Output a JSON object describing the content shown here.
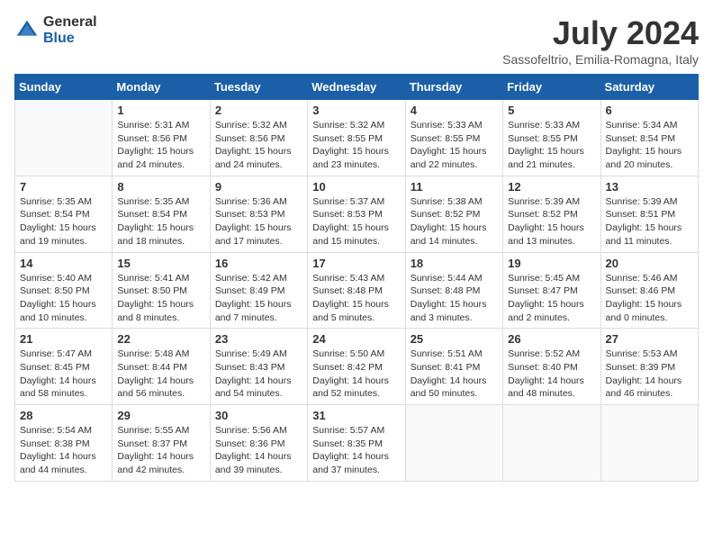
{
  "logo": {
    "general": "General",
    "blue": "Blue"
  },
  "title": "July 2024",
  "subtitle": "Sassofeltrio, Emilia-Romagna, Italy",
  "days_of_week": [
    "Sunday",
    "Monday",
    "Tuesday",
    "Wednesday",
    "Thursday",
    "Friday",
    "Saturday"
  ],
  "weeks": [
    [
      {
        "day": "",
        "info": ""
      },
      {
        "day": "1",
        "info": "Sunrise: 5:31 AM\nSunset: 8:56 PM\nDaylight: 15 hours\nand 24 minutes."
      },
      {
        "day": "2",
        "info": "Sunrise: 5:32 AM\nSunset: 8:56 PM\nDaylight: 15 hours\nand 24 minutes."
      },
      {
        "day": "3",
        "info": "Sunrise: 5:32 AM\nSunset: 8:55 PM\nDaylight: 15 hours\nand 23 minutes."
      },
      {
        "day": "4",
        "info": "Sunrise: 5:33 AM\nSunset: 8:55 PM\nDaylight: 15 hours\nand 22 minutes."
      },
      {
        "day": "5",
        "info": "Sunrise: 5:33 AM\nSunset: 8:55 PM\nDaylight: 15 hours\nand 21 minutes."
      },
      {
        "day": "6",
        "info": "Sunrise: 5:34 AM\nSunset: 8:54 PM\nDaylight: 15 hours\nand 20 minutes."
      }
    ],
    [
      {
        "day": "7",
        "info": "Sunrise: 5:35 AM\nSunset: 8:54 PM\nDaylight: 15 hours\nand 19 minutes."
      },
      {
        "day": "8",
        "info": "Sunrise: 5:35 AM\nSunset: 8:54 PM\nDaylight: 15 hours\nand 18 minutes."
      },
      {
        "day": "9",
        "info": "Sunrise: 5:36 AM\nSunset: 8:53 PM\nDaylight: 15 hours\nand 17 minutes."
      },
      {
        "day": "10",
        "info": "Sunrise: 5:37 AM\nSunset: 8:53 PM\nDaylight: 15 hours\nand 15 minutes."
      },
      {
        "day": "11",
        "info": "Sunrise: 5:38 AM\nSunset: 8:52 PM\nDaylight: 15 hours\nand 14 minutes."
      },
      {
        "day": "12",
        "info": "Sunrise: 5:39 AM\nSunset: 8:52 PM\nDaylight: 15 hours\nand 13 minutes."
      },
      {
        "day": "13",
        "info": "Sunrise: 5:39 AM\nSunset: 8:51 PM\nDaylight: 15 hours\nand 11 minutes."
      }
    ],
    [
      {
        "day": "14",
        "info": "Sunrise: 5:40 AM\nSunset: 8:50 PM\nDaylight: 15 hours\nand 10 minutes."
      },
      {
        "day": "15",
        "info": "Sunrise: 5:41 AM\nSunset: 8:50 PM\nDaylight: 15 hours\nand 8 minutes."
      },
      {
        "day": "16",
        "info": "Sunrise: 5:42 AM\nSunset: 8:49 PM\nDaylight: 15 hours\nand 7 minutes."
      },
      {
        "day": "17",
        "info": "Sunrise: 5:43 AM\nSunset: 8:48 PM\nDaylight: 15 hours\nand 5 minutes."
      },
      {
        "day": "18",
        "info": "Sunrise: 5:44 AM\nSunset: 8:48 PM\nDaylight: 15 hours\nand 3 minutes."
      },
      {
        "day": "19",
        "info": "Sunrise: 5:45 AM\nSunset: 8:47 PM\nDaylight: 15 hours\nand 2 minutes."
      },
      {
        "day": "20",
        "info": "Sunrise: 5:46 AM\nSunset: 8:46 PM\nDaylight: 15 hours\nand 0 minutes."
      }
    ],
    [
      {
        "day": "21",
        "info": "Sunrise: 5:47 AM\nSunset: 8:45 PM\nDaylight: 14 hours\nand 58 minutes."
      },
      {
        "day": "22",
        "info": "Sunrise: 5:48 AM\nSunset: 8:44 PM\nDaylight: 14 hours\nand 56 minutes."
      },
      {
        "day": "23",
        "info": "Sunrise: 5:49 AM\nSunset: 8:43 PM\nDaylight: 14 hours\nand 54 minutes."
      },
      {
        "day": "24",
        "info": "Sunrise: 5:50 AM\nSunset: 8:42 PM\nDaylight: 14 hours\nand 52 minutes."
      },
      {
        "day": "25",
        "info": "Sunrise: 5:51 AM\nSunset: 8:41 PM\nDaylight: 14 hours\nand 50 minutes."
      },
      {
        "day": "26",
        "info": "Sunrise: 5:52 AM\nSunset: 8:40 PM\nDaylight: 14 hours\nand 48 minutes."
      },
      {
        "day": "27",
        "info": "Sunrise: 5:53 AM\nSunset: 8:39 PM\nDaylight: 14 hours\nand 46 minutes."
      }
    ],
    [
      {
        "day": "28",
        "info": "Sunrise: 5:54 AM\nSunset: 8:38 PM\nDaylight: 14 hours\nand 44 minutes."
      },
      {
        "day": "29",
        "info": "Sunrise: 5:55 AM\nSunset: 8:37 PM\nDaylight: 14 hours\nand 42 minutes."
      },
      {
        "day": "30",
        "info": "Sunrise: 5:56 AM\nSunset: 8:36 PM\nDaylight: 14 hours\nand 39 minutes."
      },
      {
        "day": "31",
        "info": "Sunrise: 5:57 AM\nSunset: 8:35 PM\nDaylight: 14 hours\nand 37 minutes."
      },
      {
        "day": "",
        "info": ""
      },
      {
        "day": "",
        "info": ""
      },
      {
        "day": "",
        "info": ""
      }
    ]
  ]
}
